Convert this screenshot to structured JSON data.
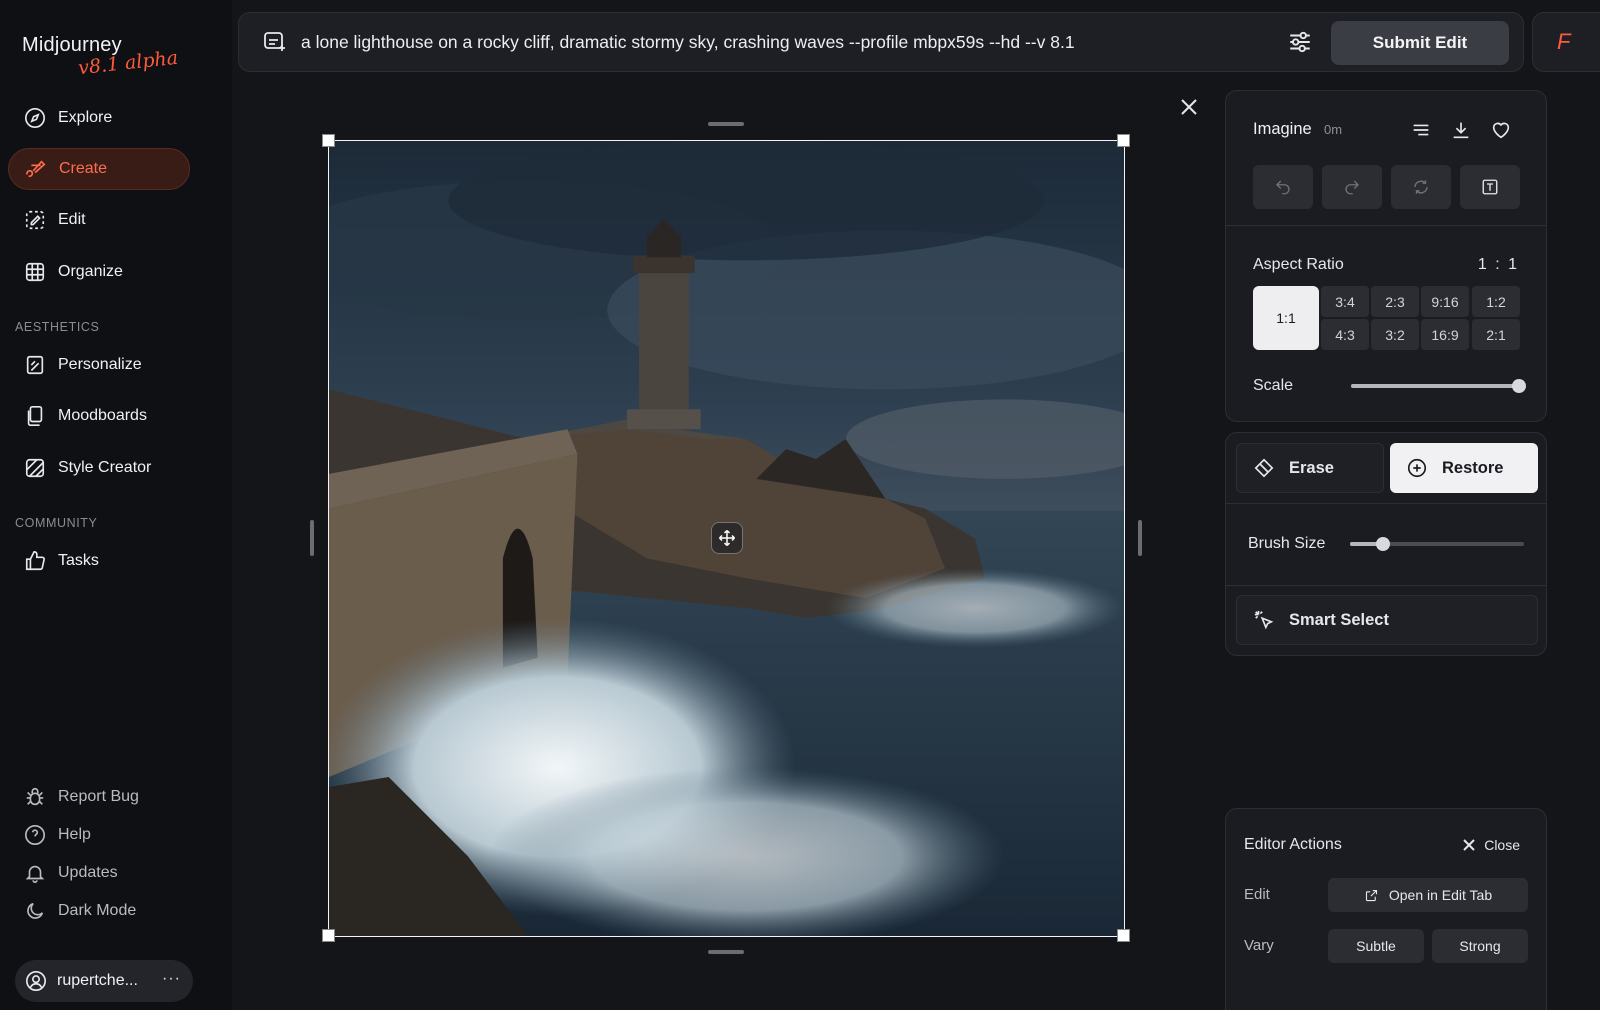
{
  "brand": {
    "name": "Midjourney",
    "version": "v8.1 alpha"
  },
  "sidebar": {
    "items": [
      {
        "label": "Explore",
        "icon": "compass-icon"
      },
      {
        "label": "Create",
        "icon": "brush-icon",
        "active": true
      },
      {
        "label": "Edit",
        "icon": "edit-frame-icon"
      },
      {
        "label": "Organize",
        "icon": "grid-icon"
      }
    ],
    "aesthetics_label": "AESTHETICS",
    "aesthetics": [
      {
        "label": "Personalize",
        "icon": "personalize-icon"
      },
      {
        "label": "Moodboards",
        "icon": "moodboard-icon"
      },
      {
        "label": "Style Creator",
        "icon": "style-creator-icon"
      }
    ],
    "community_label": "COMMUNITY",
    "community": [
      {
        "label": "Tasks",
        "icon": "thumbs-up-icon"
      }
    ],
    "footer": [
      {
        "label": "Report Bug",
        "icon": "bug-icon"
      },
      {
        "label": "Help",
        "icon": "help-icon"
      },
      {
        "label": "Updates",
        "icon": "bell-icon"
      },
      {
        "label": "Dark Mode",
        "icon": "moon-icon"
      }
    ],
    "user": {
      "name": "rupertche...",
      "more": "···"
    }
  },
  "prompt": {
    "text": "a lone lighthouse on a rocky cliff, dramatic stormy sky, crashing waves --profile mbpx59s --hd --v 8.1",
    "submit_label": "Submit Edit"
  },
  "panel": {
    "job_title": "Imagine",
    "job_time": "0m",
    "aspect_ratio_label": "Aspect Ratio",
    "aspect_ratio_value": "1 : 1",
    "aspect_selected": "1:1",
    "aspect_options": [
      "3:4",
      "2:3",
      "9:16",
      "1:2",
      "4:3",
      "3:2",
      "16:9",
      "2:1"
    ],
    "scale_label": "Scale",
    "scale_value": 1.0,
    "erase_label": "Erase",
    "restore_label": "Restore",
    "brush_size_label": "Brush Size",
    "brush_size_value": 0.19,
    "smart_select_label": "Smart Select"
  },
  "editor_actions": {
    "title": "Editor Actions",
    "close_label": "Close",
    "edit_label": "Edit",
    "open_edit_tab_label": "Open in Edit Tab",
    "vary_label": "Vary",
    "subtle_label": "Subtle",
    "strong_label": "Strong"
  },
  "colors": {
    "accent": "#ff5a3c",
    "active_bg": "#3a1c17",
    "panel_bg": "#1b1c21",
    "page_bg": "#141519"
  }
}
